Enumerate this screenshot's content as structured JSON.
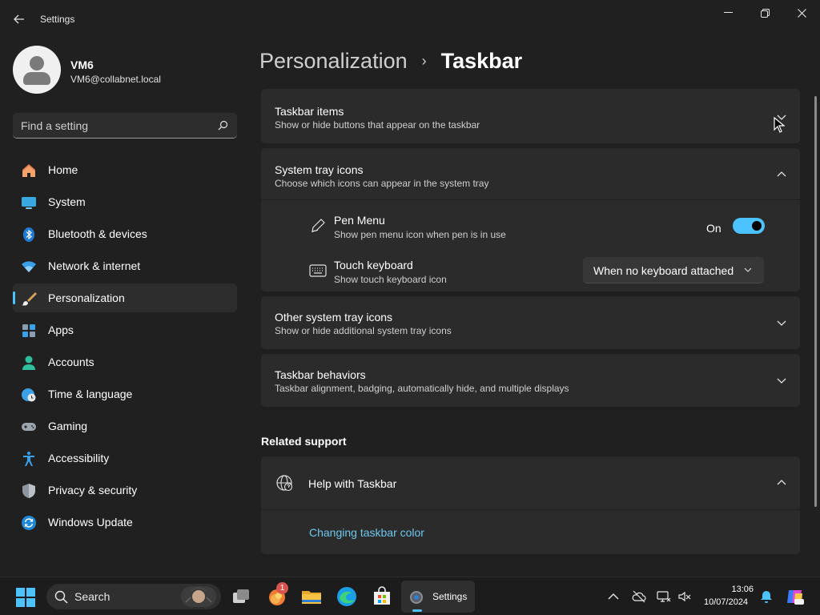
{
  "window": {
    "title": "Settings",
    "back_icon": "back-arrow-icon",
    "minimize_icon": "minimize-icon",
    "maximize_icon": "restore-icon",
    "close_icon": "close-icon"
  },
  "profile": {
    "name": "VM6",
    "email": "VM6@collabnet.local"
  },
  "search": {
    "placeholder": "Find a setting",
    "icon": "search-icon"
  },
  "sidebar": {
    "items": [
      {
        "label": "Home",
        "icon": "home-icon",
        "active": false
      },
      {
        "label": "System",
        "icon": "monitor-icon",
        "active": false
      },
      {
        "label": "Bluetooth & devices",
        "icon": "bluetooth-icon",
        "active": false
      },
      {
        "label": "Network & internet",
        "icon": "wifi-icon",
        "active": false
      },
      {
        "label": "Personalization",
        "icon": "brush-icon",
        "active": true
      },
      {
        "label": "Apps",
        "icon": "apps-icon",
        "active": false
      },
      {
        "label": "Accounts",
        "icon": "person-icon",
        "active": false
      },
      {
        "label": "Time & language",
        "icon": "globe-clock-icon",
        "active": false
      },
      {
        "label": "Gaming",
        "icon": "gamepad-icon",
        "active": false
      },
      {
        "label": "Accessibility",
        "icon": "accessibility-icon",
        "active": false
      },
      {
        "label": "Privacy & security",
        "icon": "shield-icon",
        "active": false
      },
      {
        "label": "Windows Update",
        "icon": "update-icon",
        "active": false
      }
    ]
  },
  "breadcrumb": {
    "parent": "Personalization",
    "separator": "›",
    "current": "Taskbar"
  },
  "cards": {
    "taskbar_items": {
      "title": "Taskbar items",
      "subtitle": "Show or hide buttons that appear on the taskbar",
      "expanded": false
    },
    "system_tray": {
      "title": "System tray icons",
      "subtitle": "Choose which icons can appear in the system tray",
      "expanded": true,
      "pen_menu": {
        "title": "Pen Menu",
        "subtitle": "Show pen menu icon when pen is in use",
        "state_label": "On",
        "enabled": true,
        "icon": "pen-icon"
      },
      "touch_keyboard": {
        "title": "Touch keyboard",
        "subtitle": "Show touch keyboard icon",
        "selected": "When no keyboard attached",
        "icon": "keyboard-icon"
      }
    },
    "other_tray": {
      "title": "Other system tray icons",
      "subtitle": "Show or hide additional system tray icons",
      "expanded": false
    },
    "behaviors": {
      "title": "Taskbar behaviors",
      "subtitle": "Taskbar alignment, badging, automatically hide, and multiple displays",
      "expanded": false
    }
  },
  "related_support": {
    "heading": "Related support",
    "help": {
      "title": "Help with Taskbar",
      "icon": "globe-icon",
      "expanded": true,
      "link": "Changing taskbar color"
    }
  },
  "taskbar": {
    "search_label": "Search",
    "apps": [
      {
        "name": "task-view-icon"
      },
      {
        "name": "copilot-icon",
        "badge": "1"
      },
      {
        "name": "file-explorer-icon"
      },
      {
        "name": "edge-icon"
      },
      {
        "name": "store-icon"
      }
    ],
    "active_app": "Settings",
    "tray": [
      "chevron-up-icon",
      "cloud-offline-icon",
      "network-icon",
      "volume-mute-icon",
      "notification-bell-icon",
      "copilot-preview-icon"
    ],
    "time": "13:06",
    "date": "10/07/2024"
  },
  "colors": {
    "accent": "#4cc2ff",
    "background": "#202020",
    "card": "#2b2b2b",
    "link": "#6ec7ee"
  }
}
